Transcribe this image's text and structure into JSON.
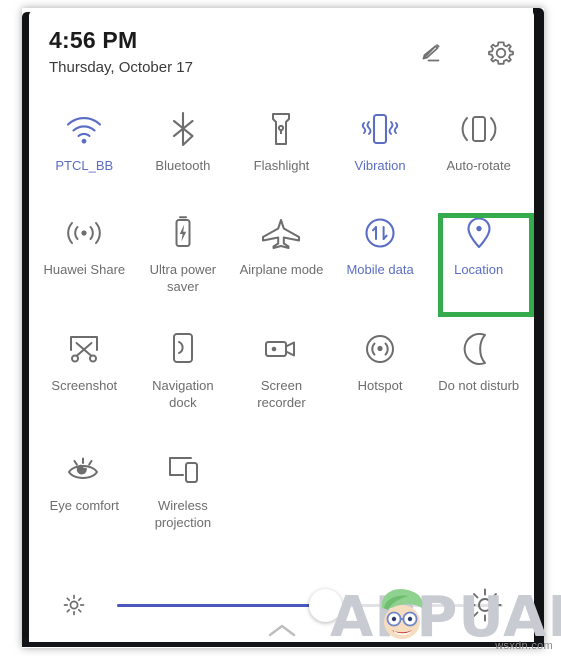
{
  "device": {
    "panel_title": "quick-settings-shade"
  },
  "header": {
    "time": "4:56 PM",
    "date": "Thursday, October 17",
    "edit_label": "Edit",
    "settings_label": "Settings"
  },
  "colors": {
    "active_blue": "#5b6ec4",
    "inactive_gray": "#6d6d6d",
    "highlight_green": "#34ab4d",
    "slider_fill": "#4a57bd"
  },
  "tiles": [
    [
      {
        "id": "wifi",
        "label": "PTCL_BB",
        "icon": "wifi-icon",
        "active": true
      },
      {
        "id": "bluetooth",
        "label": "Bluetooth",
        "icon": "bluetooth-icon",
        "active": false
      },
      {
        "id": "flashlight",
        "label": "Flashlight",
        "icon": "flashlight-icon",
        "active": false
      },
      {
        "id": "vibration",
        "label": "Vibration",
        "icon": "vibration-icon",
        "active": true
      },
      {
        "id": "auto-rotate",
        "label": "Auto-rotate",
        "icon": "auto-rotate-icon",
        "active": false
      }
    ],
    [
      {
        "id": "huawei-share",
        "label": "Huawei Share",
        "icon": "huawei-share-icon",
        "active": false
      },
      {
        "id": "ultra-power-saver",
        "label": "Ultra power saver",
        "icon": "battery-bolt-icon",
        "active": false
      },
      {
        "id": "airplane-mode",
        "label": "Airplane mode",
        "icon": "airplane-icon",
        "active": false
      },
      {
        "id": "mobile-data",
        "label": "Mobile data",
        "icon": "mobile-data-icon",
        "active": true
      },
      {
        "id": "location",
        "label": "Location",
        "icon": "location-pin-icon",
        "active": true,
        "highlighted": true
      }
    ],
    [
      {
        "id": "screenshot",
        "label": "Screenshot",
        "icon": "screenshot-scissors-icon",
        "active": false
      },
      {
        "id": "navigation-dock",
        "label": "Navigation dock",
        "icon": "navigation-dock-icon",
        "active": false
      },
      {
        "id": "screen-recorder",
        "label": "Screen recorder",
        "icon": "screen-recorder-icon",
        "active": false
      },
      {
        "id": "hotspot",
        "label": "Hotspot",
        "icon": "hotspot-icon",
        "active": false
      },
      {
        "id": "do-not-disturb",
        "label": "Do not disturb",
        "icon": "moon-icon",
        "active": false
      }
    ],
    [
      {
        "id": "eye-comfort",
        "label": "Eye comfort",
        "icon": "eye-comfort-icon",
        "active": false
      },
      {
        "id": "wireless-projection",
        "label": "Wireless projection",
        "icon": "wireless-projection-icon",
        "active": false
      }
    ]
  ],
  "brightness": {
    "label": "Brightness",
    "low_icon": "sun-small-icon",
    "high_icon": "sun-large-icon",
    "value_percent": 54
  },
  "handle": {
    "label": "Collapse",
    "icon": "chevron-up-icon"
  },
  "watermark": {
    "text": "APPUALS",
    "site": "wsxdn.com"
  }
}
